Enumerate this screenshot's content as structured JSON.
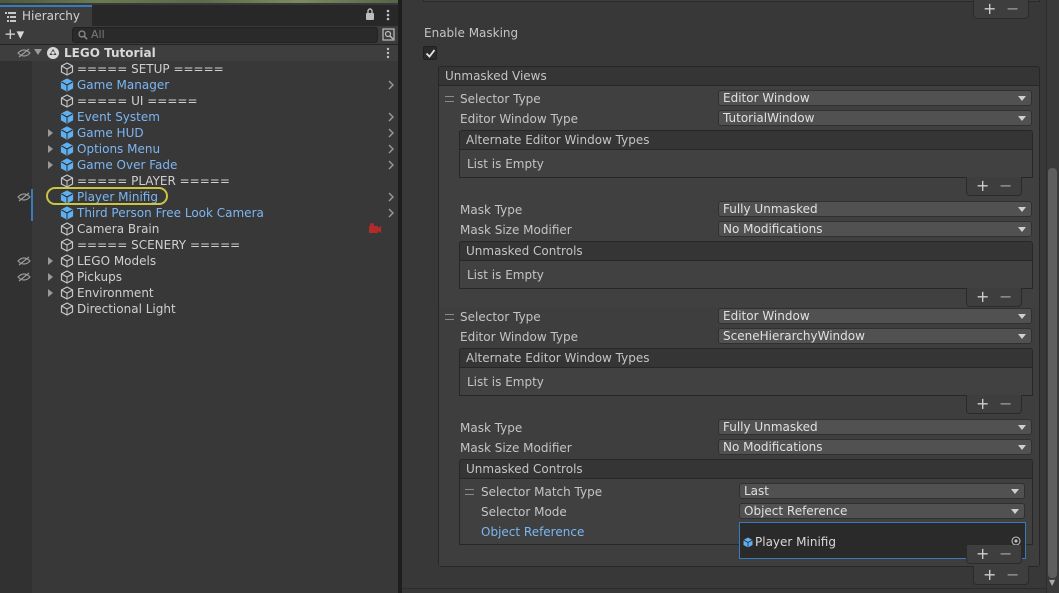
{
  "hierarchy": {
    "tab_title": "Hierarchy",
    "add_label": "+▾",
    "search_placeholder": "All",
    "scene_name": "LEGO Tutorial",
    "items": [
      {
        "label": "===== SETUP =====",
        "color": "white",
        "chevron": false,
        "foldout": false
      },
      {
        "label": "Game Manager",
        "color": "blue",
        "chevron": true,
        "foldout": false
      },
      {
        "label": "===== UI =====",
        "color": "white",
        "chevron": false,
        "foldout": false
      },
      {
        "label": "Event System",
        "color": "blue",
        "chevron": true,
        "foldout": false
      },
      {
        "label": "Game HUD",
        "color": "blue",
        "chevron": true,
        "foldout": true
      },
      {
        "label": "Options Menu",
        "color": "blue",
        "chevron": true,
        "foldout": true
      },
      {
        "label": "Game Over Fade",
        "color": "blue",
        "chevron": true,
        "foldout": true
      },
      {
        "label": "===== PLAYER =====",
        "color": "white",
        "chevron": false,
        "foldout": false
      },
      {
        "label": "Player Minifig",
        "color": "blue",
        "chevron": true,
        "foldout": false,
        "highlighted": true
      },
      {
        "label": "Third Person Free Look Camera",
        "color": "blue",
        "chevron": true,
        "foldout": false
      },
      {
        "label": "Camera Brain",
        "color": "white",
        "chevron": false,
        "foldout": false
      },
      {
        "label": "===== SCENERY =====",
        "color": "white",
        "chevron": false,
        "foldout": false
      },
      {
        "label": "LEGO Models",
        "color": "white",
        "chevron": false,
        "foldout": true
      },
      {
        "label": "Pickups",
        "color": "white",
        "chevron": false,
        "foldout": true
      },
      {
        "label": "Environment",
        "color": "white",
        "chevron": false,
        "foldout": true
      },
      {
        "label": "Directional Light",
        "color": "white",
        "chevron": false,
        "foldout": false
      }
    ]
  },
  "inspector": {
    "enable_masking_label": "Enable Masking",
    "enable_masking_checked": true,
    "unmasked_views_label": "Unmasked Views",
    "view1": {
      "selector_type_label": "Selector Type",
      "selector_type_value": "Editor Window",
      "editor_window_type_label": "Editor Window Type",
      "editor_window_type_value": "TutorialWindow",
      "alt_types_label": "Alternate Editor Window Types",
      "alt_types_empty": "List is Empty",
      "mask_type_label": "Mask Type",
      "mask_type_value": "Fully Unmasked",
      "mask_size_label": "Mask Size Modifier",
      "mask_size_value": "No Modifications",
      "unmasked_controls_label": "Unmasked Controls",
      "unmasked_controls_empty": "List is Empty"
    },
    "view2": {
      "selector_type_label": "Selector Type",
      "selector_type_value": "Editor Window",
      "editor_window_type_label": "Editor Window Type",
      "editor_window_type_value": "SceneHierarchyWindow",
      "alt_types_label": "Alternate Editor Window Types",
      "alt_types_empty": "List is Empty",
      "mask_type_label": "Mask Type",
      "mask_type_value": "Fully Unmasked",
      "mask_size_label": "Mask Size Modifier",
      "mask_size_value": "No Modifications",
      "unmasked_controls_label": "Unmasked Controls",
      "control": {
        "match_type_label": "Selector Match Type",
        "match_type_value": "Last",
        "mode_label": "Selector Mode",
        "mode_value": "Object Reference",
        "object_ref_label": "Object Reference",
        "object_ref_value": "Player Minifig"
      }
    },
    "plus": "+",
    "minus": "−"
  }
}
